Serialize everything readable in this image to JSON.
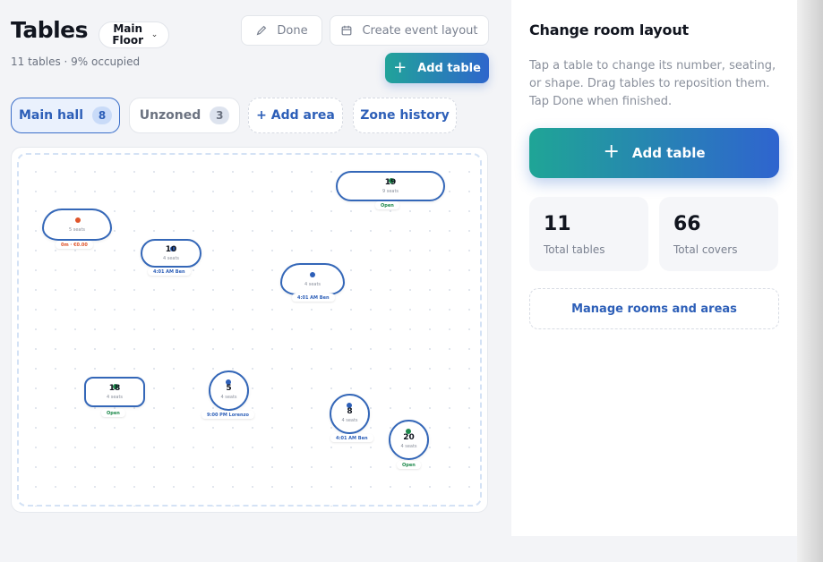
{
  "header": {
    "title": "Tables",
    "floor_label": "Main Floor",
    "subtitle": "11 tables · 9% occupied",
    "done_label": "Done",
    "create_layout_label": "Create event layout",
    "add_table_label": "Add table"
  },
  "tabs": [
    {
      "label": "Main hall",
      "count": "8"
    },
    {
      "label": "Unzoned",
      "count": "3"
    },
    {
      "label": "+ Add area"
    },
    {
      "label": "Zone history"
    }
  ],
  "tables": [
    {
      "id": "t1",
      "number": "",
      "seats": "5 seats",
      "status": "0m · €0.00",
      "status_color": "#e0552b",
      "dot": "#e0552b"
    },
    {
      "id": "t2",
      "number": "10",
      "seats": "4 seats",
      "status": "4:01 AM Ben",
      "status_color": "#2d5fb8",
      "dot": "#2d5fb8"
    },
    {
      "id": "t3",
      "number": "",
      "seats": "4 seats",
      "status": "4:01 AM Ben",
      "status_color": "#2d5fb8",
      "dot": "#2d5fb8"
    },
    {
      "id": "t4",
      "number": "19",
      "seats": "9 seats",
      "status": "Open",
      "status_color": "#1f8a4c",
      "dot": "#1f8a4c"
    },
    {
      "id": "t5",
      "number": "18",
      "seats": "4 seats",
      "status": "Open",
      "status_color": "#1f8a4c",
      "dot": "#1f8a4c"
    },
    {
      "id": "t6",
      "number": "5",
      "seats": "4 seats",
      "status": "9:00 PM Lorenzo",
      "status_color": "#2d5fb8",
      "dot": "#2d5fb8"
    },
    {
      "id": "t7",
      "number": "8",
      "seats": "4 seats",
      "status": "4:01 AM Ben",
      "status_color": "#2d5fb8",
      "dot": "#2d5fb8"
    },
    {
      "id": "t8",
      "number": "20",
      "seats": "4 seats",
      "status": "Open",
      "status_color": "#1f8a4c",
      "dot": "#1f8a4c"
    }
  ],
  "panel": {
    "title": "Change room layout",
    "description": "Tap a table to change its number, seating, or shape. Drag tables to reposition them. Tap Done when finished.",
    "add_table_label": "Add table",
    "stats": [
      {
        "value": "11",
        "label": "Total tables"
      },
      {
        "value": "66",
        "label": "Total covers"
      }
    ],
    "manage_label": "Manage rooms and areas"
  },
  "colors": {
    "accent_blue": "#2d5fb8",
    "gradient_start": "#21a39a",
    "gradient_end": "#2e66cc"
  },
  "icons": {
    "done": "pencil-icon",
    "create_layout": "calendar-icon",
    "add": "plus-icon",
    "floor_select": "chevron-down-icon"
  }
}
